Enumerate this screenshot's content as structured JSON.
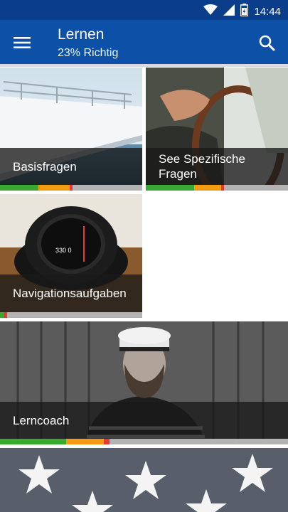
{
  "status": {
    "time": "14:44"
  },
  "appbar": {
    "title": "Lernen",
    "subtitle": "23% Richtig"
  },
  "icons": {
    "menu": "menu-icon",
    "search": "search-icon",
    "wifi": "wifi-icon",
    "signal": "signal-icon",
    "battery": "battery-icon"
  },
  "colors": {
    "statusbar": "#0a3d8a",
    "appbar": "#0d50a8",
    "correct": "#3aa832",
    "partial": "#f39c12",
    "wrong": "#e53935",
    "unanswered": "#b3b3b3"
  },
  "tiles": [
    {
      "label": "Basisfragen",
      "progress": {
        "correct": 0.27,
        "partial": 0.22,
        "wrong": 0.02
      }
    },
    {
      "label": "See Spezifische Fragen",
      "progress": {
        "correct": 0.34,
        "partial": 0.19,
        "wrong": 0.02
      }
    },
    {
      "label": "Navigationsaufgaben",
      "progress": {
        "correct": 0.03,
        "partial": 0.0,
        "wrong": 0.02
      }
    },
    {
      "label": "Lerncoach",
      "progress": {
        "correct": 0.23,
        "partial": 0.13,
        "wrong": 0.02
      }
    }
  ]
}
